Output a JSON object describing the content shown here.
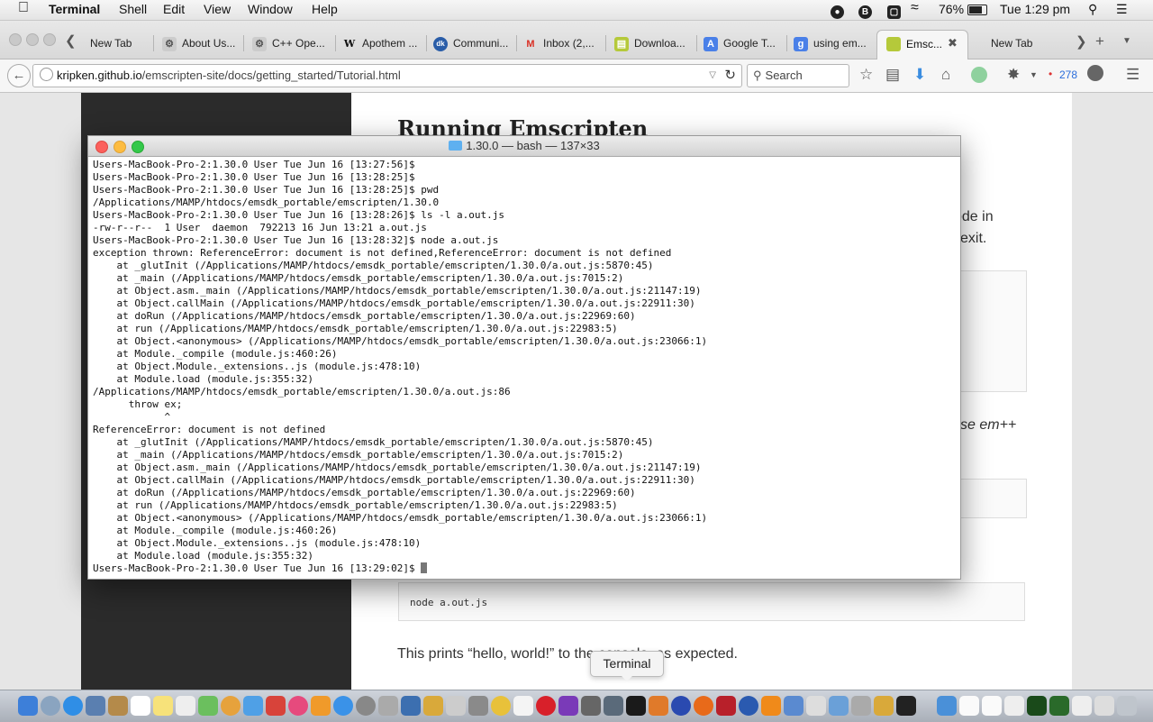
{
  "menubar": {
    "app": "Terminal",
    "items": [
      "Shell",
      "Edit",
      "View",
      "Window",
      "Help"
    ],
    "battery": "76%",
    "clock": "Tue 1:29 pm"
  },
  "browser": {
    "tabs": [
      "New Tab",
      "About Us...",
      "C++ Ope...",
      "Apothem ...",
      "Communi...",
      "Inbox (2,...",
      "Downloa...",
      "Google T...",
      "using em...",
      "Emsc...",
      "New Tab"
    ],
    "url_domain": "kripken.github.io",
    "url_path": "/emscripten-site/docs/getting_started/Tutorial.html",
    "search_placeholder": "Search",
    "badge_count": "278"
  },
  "page": {
    "heading": "Running Emscripten",
    "frag_code_in": "code in",
    "frag_exit": "exit.",
    "frag_em": "se em++",
    "code": "node a.out.js",
    "text_line": "This prints “hello, world!” to the console, as expected."
  },
  "terminal": {
    "title": "1.30.0 — bash — 137×33",
    "lines": [
      "Users-MacBook-Pro-2:1.30.0 User Tue Jun 16 [13:27:56]$",
      "Users-MacBook-Pro-2:1.30.0 User Tue Jun 16 [13:28:25]$",
      "Users-MacBook-Pro-2:1.30.0 User Tue Jun 16 [13:28:25]$ pwd",
      "/Applications/MAMP/htdocs/emsdk_portable/emscripten/1.30.0",
      "Users-MacBook-Pro-2:1.30.0 User Tue Jun 16 [13:28:26]$ ls -l a.out.js",
      "-rw-r--r--  1 User  daemon  792213 16 Jun 13:21 a.out.js",
      "Users-MacBook-Pro-2:1.30.0 User Tue Jun 16 [13:28:32]$ node a.out.js",
      "exception thrown: ReferenceError: document is not defined,ReferenceError: document is not defined",
      "    at _glutInit (/Applications/MAMP/htdocs/emsdk_portable/emscripten/1.30.0/a.out.js:5870:45)",
      "    at _main (/Applications/MAMP/htdocs/emsdk_portable/emscripten/1.30.0/a.out.js:7015:2)",
      "    at Object.asm._main (/Applications/MAMP/htdocs/emsdk_portable/emscripten/1.30.0/a.out.js:21147:19)",
      "    at Object.callMain (/Applications/MAMP/htdocs/emsdk_portable/emscripten/1.30.0/a.out.js:22911:30)",
      "    at doRun (/Applications/MAMP/htdocs/emsdk_portable/emscripten/1.30.0/a.out.js:22969:60)",
      "    at run (/Applications/MAMP/htdocs/emsdk_portable/emscripten/1.30.0/a.out.js:22983:5)",
      "    at Object.<anonymous> (/Applications/MAMP/htdocs/emsdk_portable/emscripten/1.30.0/a.out.js:23066:1)",
      "    at Module._compile (module.js:460:26)",
      "    at Object.Module._extensions..js (module.js:478:10)",
      "    at Module.load (module.js:355:32)",
      "/Applications/MAMP/htdocs/emsdk_portable/emscripten/1.30.0/a.out.js:86",
      "      throw ex;",
      "            ^",
      "ReferenceError: document is not defined",
      "    at _glutInit (/Applications/MAMP/htdocs/emsdk_portable/emscripten/1.30.0/a.out.js:5870:45)",
      "    at _main (/Applications/MAMP/htdocs/emsdk_portable/emscripten/1.30.0/a.out.js:7015:2)",
      "    at Object.asm._main (/Applications/MAMP/htdocs/emsdk_portable/emscripten/1.30.0/a.out.js:21147:19)",
      "    at Object.callMain (/Applications/MAMP/htdocs/emsdk_portable/emscripten/1.30.0/a.out.js:22911:30)",
      "    at doRun (/Applications/MAMP/htdocs/emsdk_portable/emscripten/1.30.0/a.out.js:22969:60)",
      "    at run (/Applications/MAMP/htdocs/emsdk_portable/emscripten/1.30.0/a.out.js:22983:5)",
      "    at Object.<anonymous> (/Applications/MAMP/htdocs/emsdk_portable/emscripten/1.30.0/a.out.js:23066:1)",
      "    at Module._compile (module.js:460:26)",
      "    at Object.Module._extensions..js (module.js:478:10)",
      "    at Module.load (module.js:355:32)"
    ],
    "prompt": "Users-MacBook-Pro-2:1.30.0 User Tue Jun 16 [13:29:02]$ "
  },
  "dock": {
    "tooltip": "Terminal"
  },
  "colors": {
    "close": "#fc605c",
    "minimize": "#fdbc40",
    "zoom": "#34c84a",
    "link_blue": "#2a6ddb"
  }
}
